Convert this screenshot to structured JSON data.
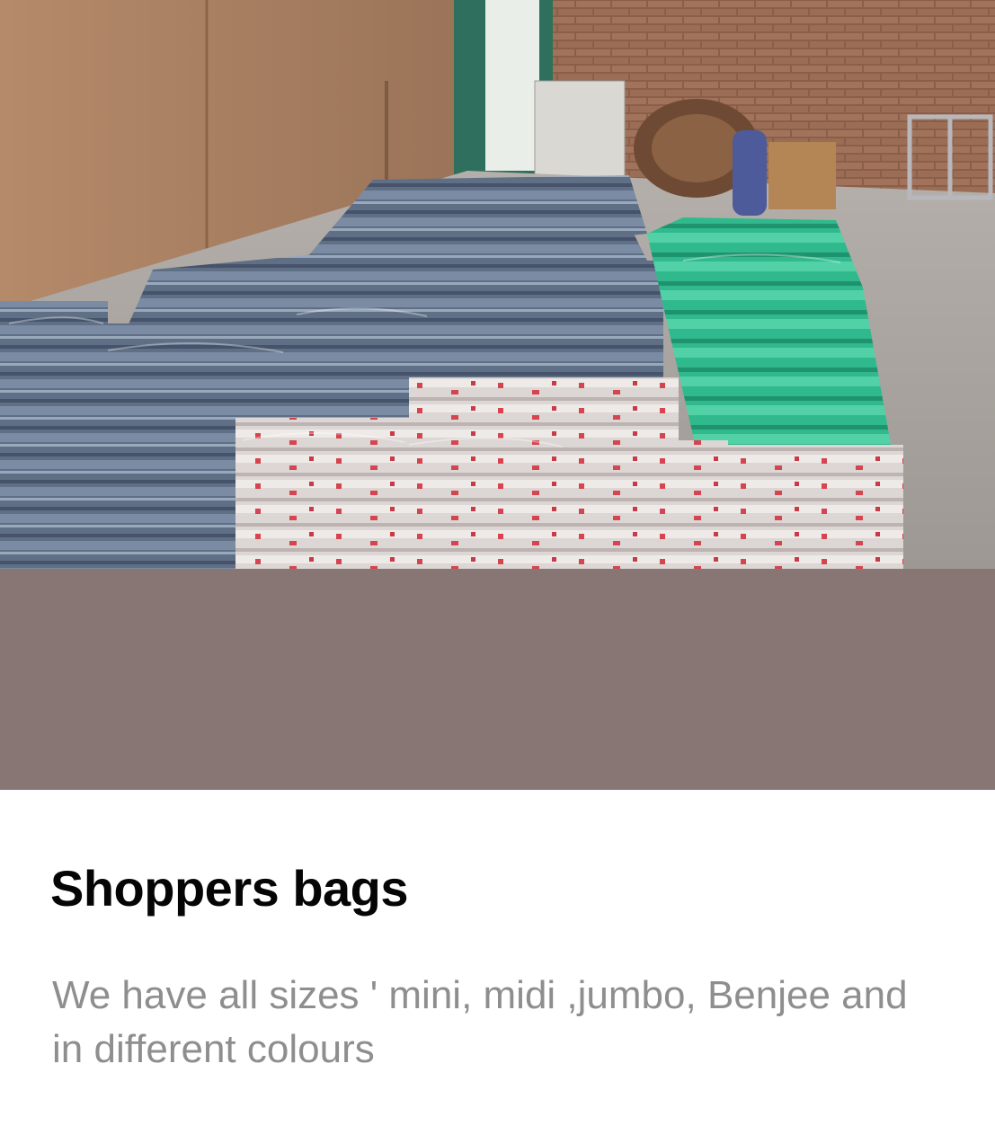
{
  "card": {
    "image_alt": "Warehouse stacked with packs of shoppers bags in blue, white and green",
    "title": "Shoppers bags",
    "description": "We have all sizes ' mini, midi ,jumbo, Benjee and in different colours"
  },
  "colors": {
    "media_background": "#877674",
    "title": "#050505",
    "description": "#8e8e8e"
  }
}
